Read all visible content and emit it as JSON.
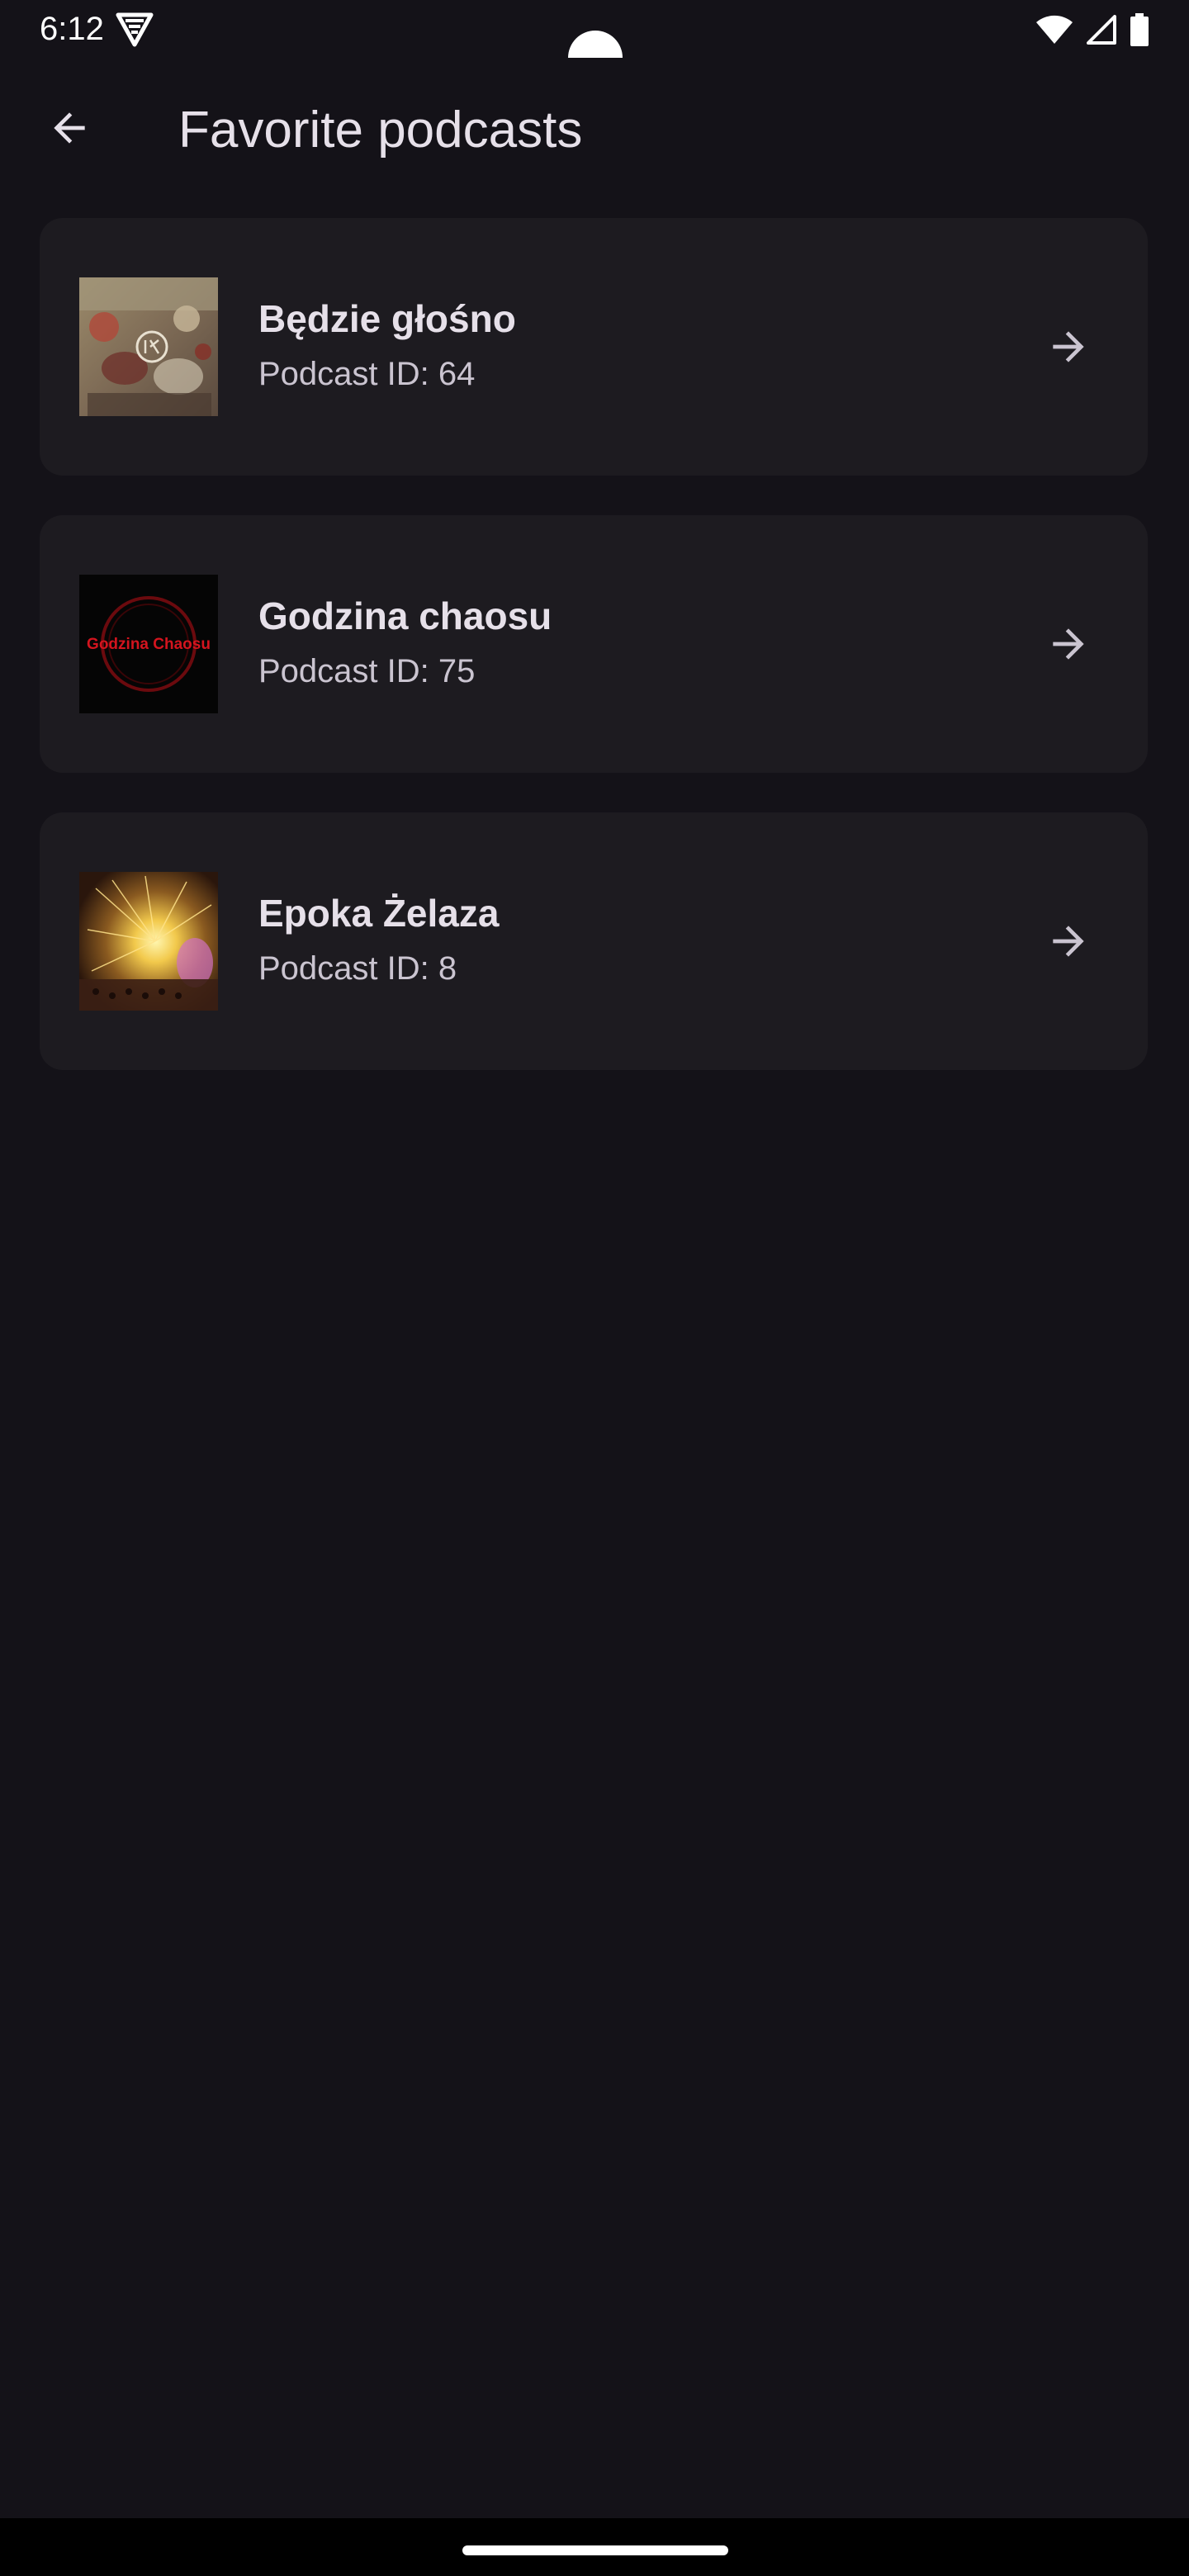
{
  "status_bar": {
    "time": "6:12",
    "app_icon": "vpn-shield-icon",
    "icons": [
      "wifi-icon",
      "cellular-signal-icon",
      "battery-icon"
    ]
  },
  "app_bar": {
    "back_icon": "arrow-back-icon",
    "title": "Favorite podcasts"
  },
  "podcasts": [
    {
      "title": "Będzie głośno",
      "subtitle": "Podcast ID: 64",
      "cover": "painting-cover-image",
      "arrow_icon": "arrow-forward-icon"
    },
    {
      "title": "Godzina chaosu",
      "subtitle": "Podcast ID: 75",
      "cover": "godzina-chaosu-logo-image",
      "cover_text": "Godzina Chaosu",
      "arrow_icon": "arrow-forward-icon"
    },
    {
      "title": "Epoka Żelaza",
      "subtitle": "Podcast ID: 8",
      "cover": "sparks-cover-image",
      "arrow_icon": "arrow-forward-icon"
    }
  ],
  "colors": {
    "background": "#141218",
    "card": "#1D1B20",
    "on_surface": "#E6E0E9",
    "on_surface_variant": "#CAC4D0",
    "cover_accent_red": "#D4141E"
  }
}
